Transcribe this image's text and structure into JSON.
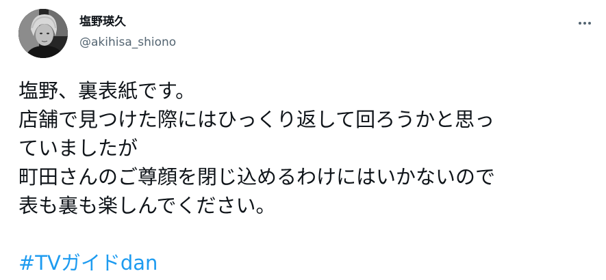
{
  "author": {
    "display_name": "塩野瑛久",
    "handle": "@akihisa_shiono",
    "avatar_icon": "profile-photo"
  },
  "more_icon": "more-horizontal-icon",
  "tweet": {
    "lines": [
      "塩野、裏表紙です。",
      "店舗で見つけた際にはひっくり返して回ろうかと思っ",
      "ていましたが",
      "町田さんのご尊顔を閉じ込めるわけにはいかないので",
      "表も裏も楽しんでください。"
    ],
    "hashtag": "#TVガイドdan"
  },
  "colors": {
    "text": "#0f1419",
    "secondary": "#536471",
    "link": "#1d9bf0"
  }
}
